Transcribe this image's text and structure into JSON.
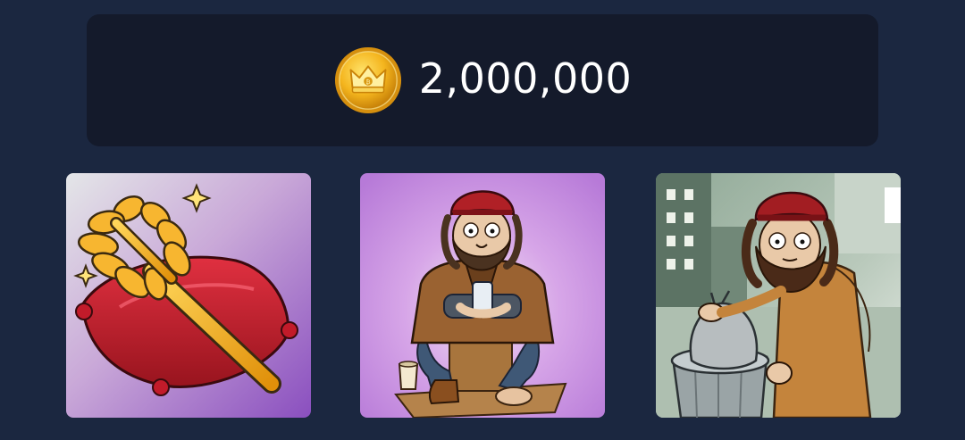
{
  "balance": {
    "currency_icon": "crown-coin-icon",
    "amount": "2,000,000"
  },
  "items": [
    {
      "icon": "toilet-brush-on-pillow-illustration",
      "background": "#9a63c7"
    },
    {
      "icon": "homeless-man-with-phone-illustration",
      "background": "#c58be0"
    },
    {
      "icon": "homeless-man-with-trash-can-illustration",
      "background": "#cfd9cf"
    }
  ],
  "colors": {
    "page_background": "#1b2740",
    "panel_background": "#141a2b",
    "coin_gold": "#f2b51c",
    "text": "#ffffff"
  }
}
